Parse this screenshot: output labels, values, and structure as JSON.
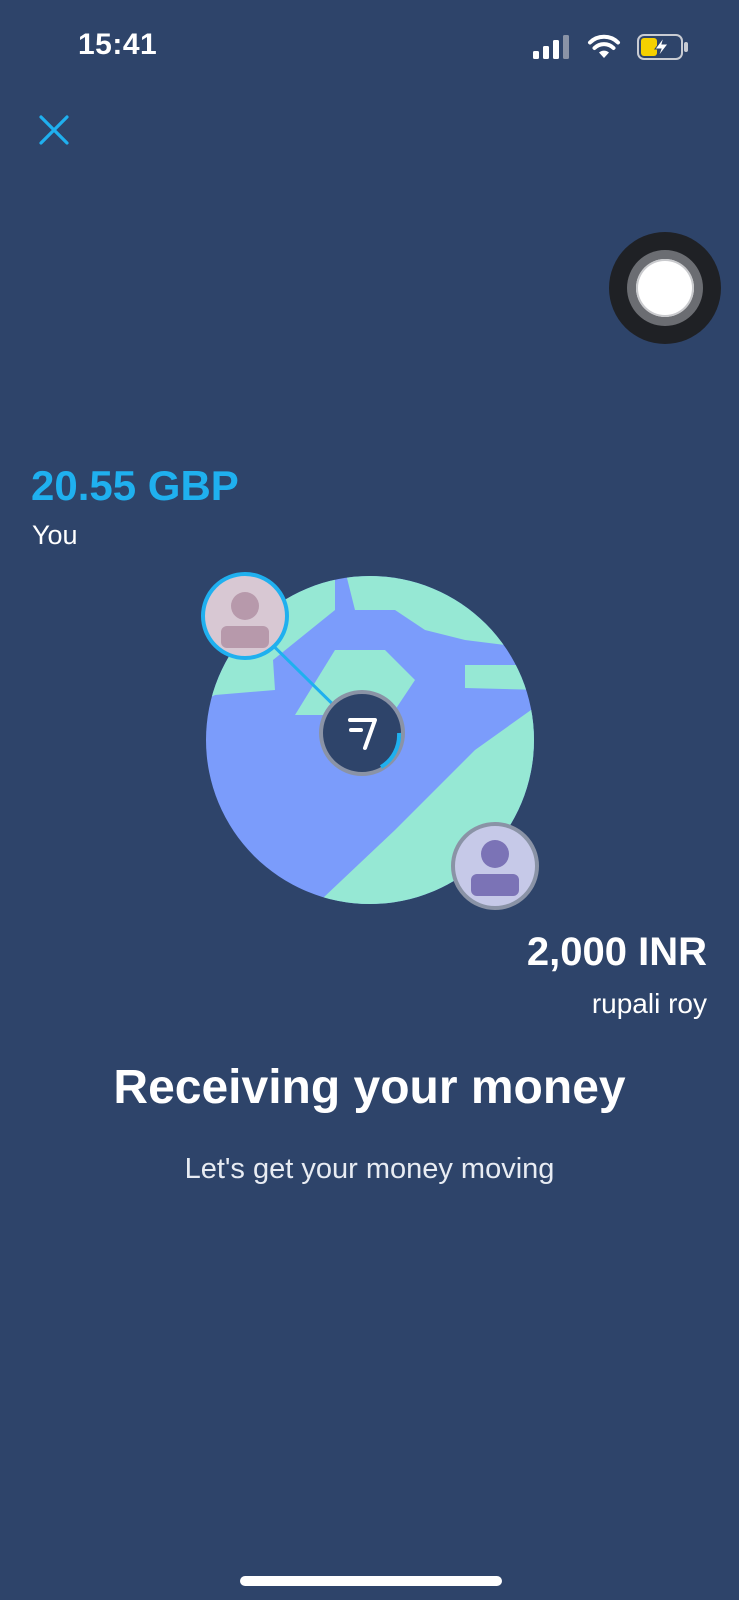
{
  "status_bar": {
    "time": "15:41",
    "signal_icon": "cellular-signal-icon",
    "wifi_icon": "wifi-icon",
    "battery_icon": "battery-charging-icon"
  },
  "nav": {
    "close_icon": "close-icon"
  },
  "transfer": {
    "sender_amount": "20.55 GBP",
    "sender_name": "You",
    "recipient_amount": "2,000 INR",
    "recipient_name": "rupali roy"
  },
  "content": {
    "headline": "Receiving your money",
    "subtitle": "Let's get your money moving"
  },
  "colors": {
    "background": "#2e446a",
    "accent": "#1fb0ef",
    "globe_water": "#7b9cfb",
    "globe_land": "#96e8d4"
  }
}
